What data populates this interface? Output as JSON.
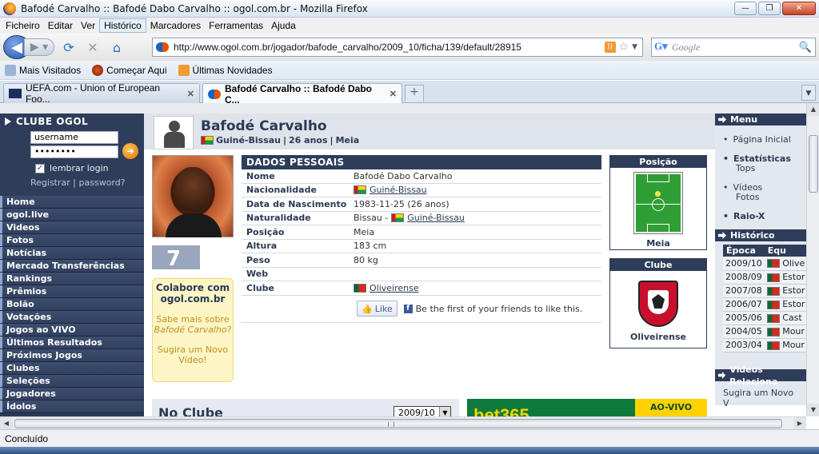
{
  "window": {
    "title": "Bafodé Carvalho :: Bafodé Dabo Carvalho :: ogol.com.br - Mozilla Firefox"
  },
  "menu": [
    "Ficheiro",
    "Editar",
    "Ver",
    "Histórico",
    "Marcadores",
    "Ferramentas",
    "Ajuda"
  ],
  "nav": {
    "url": "http://www.ogol.com.br/jogador/bafode_carvalho/2009_10/ficha/139/default/28915",
    "search_placeholder": "Google"
  },
  "bookmarks": [
    "Mais Visitados",
    "Começar Aqui",
    "Últimas Novidades"
  ],
  "tabs": [
    {
      "label": "UEFA.com - Union of European Foo..."
    },
    {
      "label": "Bafodé Carvalho :: Bafodé Dabo C..."
    }
  ],
  "login": {
    "title": "CLUBE OGOL",
    "username": "username",
    "password": "••••••••",
    "remember": "lembrar login",
    "register": "Registrar",
    "separator": "|",
    "password_link": "password?"
  },
  "leftnav": [
    "Home",
    "ogol.live",
    "Videos",
    "Fotos",
    "Notícias",
    "Mercado Transferências",
    "Rankings",
    "Prêmios",
    "Bolão",
    "Votações",
    "Jogos ao VIVO",
    "Últimos Resultados",
    "Próximos Jogos",
    "Clubes",
    "Seleções",
    "Jogadores",
    "Ídolos"
  ],
  "player": {
    "name": "Bafodé Carvalho",
    "country": "Guiné-Bissau",
    "age": "26 anos",
    "position": "Meia",
    "sep": "|",
    "number": "7"
  },
  "collab": {
    "title": "Colabore com ogol.com.br",
    "text1a": "Sabe mais sobre ",
    "text1b": "Bafodé Carvalho",
    "text1c": "?",
    "text2": "Sugira um Novo Vídeo!"
  },
  "dados": {
    "header": "DADOS PESSOAIS",
    "rows": [
      {
        "label": "Nome",
        "value": "Bafodé Dabo Carvalho"
      },
      {
        "label": "Nacionalidade",
        "value": "Guiné-Bissau"
      },
      {
        "label": "Data de Nascimento",
        "value": "1983-11-25 (26 anos)"
      },
      {
        "label": "Naturalidade",
        "value": "Bissau -",
        "value2": "Guiné-Bissau"
      },
      {
        "label": "Posição",
        "value": "Meia"
      },
      {
        "label": "Altura",
        "value": "183 cm"
      },
      {
        "label": "Peso",
        "value": "80 kg"
      },
      {
        "label": "Web",
        "value": ""
      },
      {
        "label": "Clube",
        "value": "Oliveirense"
      }
    ],
    "like": "Like",
    "fb_text": "Be the first of your friends to like this."
  },
  "posbox": {
    "head": "Posição",
    "foot": "Meia"
  },
  "clubbox": {
    "head": "Clube",
    "foot": "Oliveirense"
  },
  "noclube": {
    "title": "No Clube",
    "season": "2009/10"
  },
  "ad": {
    "logo": "bet365",
    "live": "AO-VIVO"
  },
  "rightmenu": {
    "head": "Menu",
    "items": [
      {
        "label": "Página Inicial",
        "bold": false
      },
      {
        "label": "Estatísticas",
        "bold": true
      },
      {
        "label": "Tops",
        "bold": false
      },
      {
        "label": "Vídeos",
        "bold": false
      },
      {
        "label": "Fotos",
        "bold": false
      },
      {
        "label": "Raio-X",
        "bold": true
      }
    ]
  },
  "history": {
    "head": "Histórico",
    "cols": [
      "Época",
      "Equ"
    ],
    "rows": [
      [
        "2009/10",
        "Olive"
      ],
      [
        "2008/09",
        "Estor"
      ],
      [
        "2007/08",
        "Estor"
      ],
      [
        "2006/07",
        "Estor"
      ],
      [
        "2005/06",
        "Cast"
      ],
      [
        "2004/05",
        "Mour"
      ],
      [
        "2003/04",
        "Mour"
      ]
    ]
  },
  "videos": {
    "head": "Vídeos Relaciona",
    "text": "Sugira um Novo V"
  },
  "status": "Concluído"
}
